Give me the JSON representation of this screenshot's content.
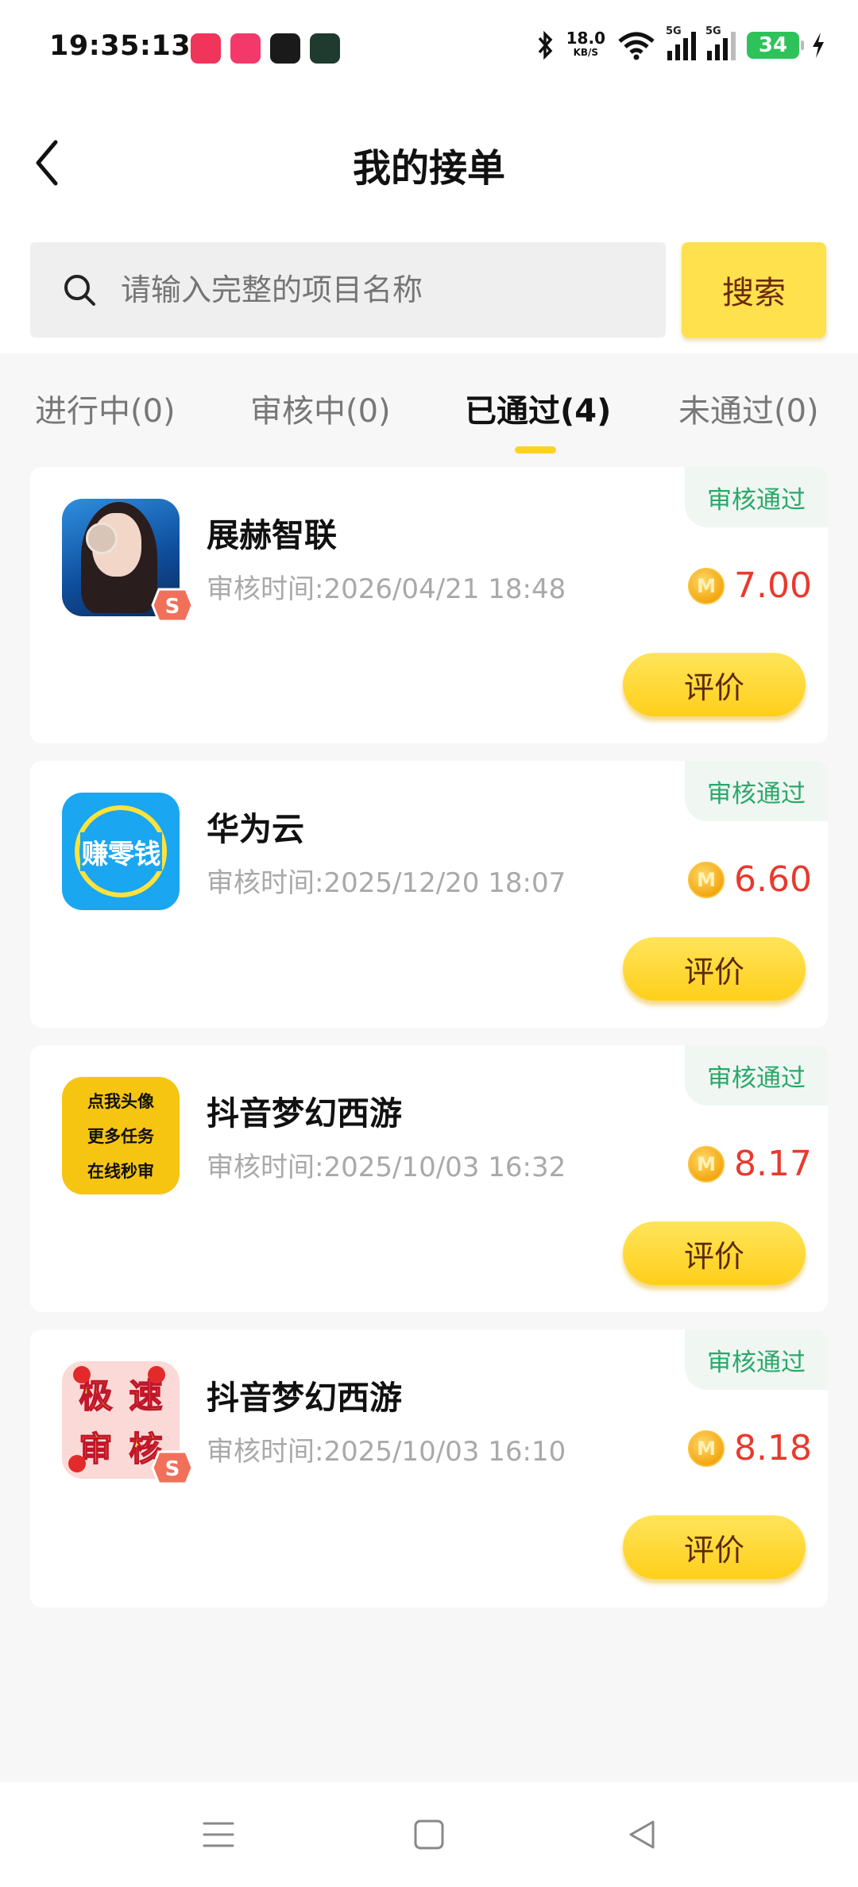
{
  "status_bar": {
    "time": "19:35:13",
    "net_speed": "18.0",
    "net_unit": "KB/S",
    "sig1_label": "5G",
    "sig2_label": "5G",
    "battery": "34",
    "icons": [
      "music-app-icon",
      "video-app-icon",
      "black-app-icon",
      "green-app-icon",
      "bluetooth-icon",
      "wifi-icon",
      "signal-icon",
      "battery-icon",
      "charging-icon"
    ]
  },
  "header": {
    "title": "我的接单",
    "back_icon": "chevron-left-icon"
  },
  "search": {
    "placeholder": "请输入完整的项目名称",
    "button_label": "搜索",
    "icon": "search-icon"
  },
  "tabs": [
    {
      "label": "进行中(0)",
      "active": false
    },
    {
      "label": "审核中(0)",
      "active": false
    },
    {
      "label": "已通过(4)",
      "active": true
    },
    {
      "label": "未通过(0)",
      "active": false
    }
  ],
  "orders": [
    {
      "name": "展赫智联",
      "time": "审核时间:2026/04/21 18:48",
      "status": "审核通过",
      "amount": "7.00",
      "coin_letter": "M",
      "action": "评价"
    },
    {
      "name": "华为云",
      "time": "审核时间:2025/12/20 18:07",
      "status": "审核通过",
      "amount": "6.60",
      "coin_letter": "M",
      "action": "评价",
      "thumb_text": "赚零钱"
    },
    {
      "name": "抖音梦幻西游",
      "time": "审核时间:2025/10/03 16:32",
      "status": "审核通过",
      "amount": "8.17",
      "coin_letter": "M",
      "action": "评价",
      "thumb_lines": [
        "点我头像",
        "更多任务",
        "在线秒审"
      ]
    },
    {
      "name": "抖音梦幻西游",
      "time": "审核时间:2025/10/03 16:10",
      "status": "审核通过",
      "amount": "8.18",
      "coin_letter": "M",
      "action": "评价",
      "thumb_chars": [
        "极",
        "速",
        "审",
        "核"
      ]
    }
  ],
  "badge_letter": "S",
  "colors": {
    "accent": "#ffd21e",
    "amount": "#e83a2e",
    "status_text": "#2aa86a",
    "status_bg": "#f0f7f3"
  }
}
